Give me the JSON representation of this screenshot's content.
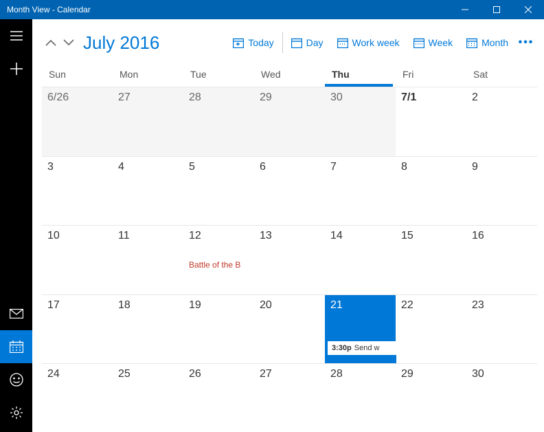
{
  "window": {
    "title": "Month View - Calendar"
  },
  "rail": {
    "items": [
      "menu",
      "add",
      "mail",
      "calendar",
      "feedback",
      "settings"
    ],
    "active": "calendar"
  },
  "header": {
    "title": "July 2016",
    "views": {
      "today": "Today",
      "day": "Day",
      "workweek": "Work week",
      "week": "Week",
      "month": "Month"
    }
  },
  "days": {
    "sun": "Sun",
    "mon": "Mon",
    "tue": "Tue",
    "wed": "Wed",
    "thu": "Thu",
    "fri": "Fri",
    "sat": "Sat",
    "todayIndex": 4
  },
  "weeks": [
    {
      "cells": [
        {
          "label": "6/26",
          "kind": "out"
        },
        {
          "label": "27",
          "kind": "out"
        },
        {
          "label": "28",
          "kind": "out"
        },
        {
          "label": "29",
          "kind": "out"
        },
        {
          "label": "30",
          "kind": "out"
        },
        {
          "label": "7/1",
          "kind": "in",
          "bold": true
        },
        {
          "label": "2",
          "kind": "in"
        }
      ]
    },
    {
      "cells": [
        {
          "label": "3",
          "kind": "in"
        },
        {
          "label": "4",
          "kind": "in"
        },
        {
          "label": "5",
          "kind": "in"
        },
        {
          "label": "6",
          "kind": "in"
        },
        {
          "label": "7",
          "kind": "in"
        },
        {
          "label": "8",
          "kind": "in"
        },
        {
          "label": "9",
          "kind": "in"
        }
      ]
    },
    {
      "cells": [
        {
          "label": "10",
          "kind": "in"
        },
        {
          "label": "11",
          "kind": "in"
        },
        {
          "label": "12",
          "kind": "in",
          "holiday": "Battle of the B"
        },
        {
          "label": "13",
          "kind": "in"
        },
        {
          "label": "14",
          "kind": "in"
        },
        {
          "label": "15",
          "kind": "in"
        },
        {
          "label": "16",
          "kind": "in"
        }
      ]
    },
    {
      "cells": [
        {
          "label": "17",
          "kind": "in"
        },
        {
          "label": "18",
          "kind": "in"
        },
        {
          "label": "19",
          "kind": "in"
        },
        {
          "label": "20",
          "kind": "in"
        },
        {
          "label": "21",
          "kind": "today",
          "event": {
            "time": "3:30p",
            "title": "Send w"
          }
        },
        {
          "label": "22",
          "kind": "in"
        },
        {
          "label": "23",
          "kind": "in"
        }
      ]
    },
    {
      "cells": [
        {
          "label": "24",
          "kind": "in"
        },
        {
          "label": "25",
          "kind": "in"
        },
        {
          "label": "26",
          "kind": "in"
        },
        {
          "label": "27",
          "kind": "in"
        },
        {
          "label": "28",
          "kind": "in"
        },
        {
          "label": "29",
          "kind": "in"
        },
        {
          "label": "30",
          "kind": "in"
        }
      ]
    }
  ],
  "colors": {
    "accent": "#0078d7",
    "holiday": "#c0392b"
  }
}
